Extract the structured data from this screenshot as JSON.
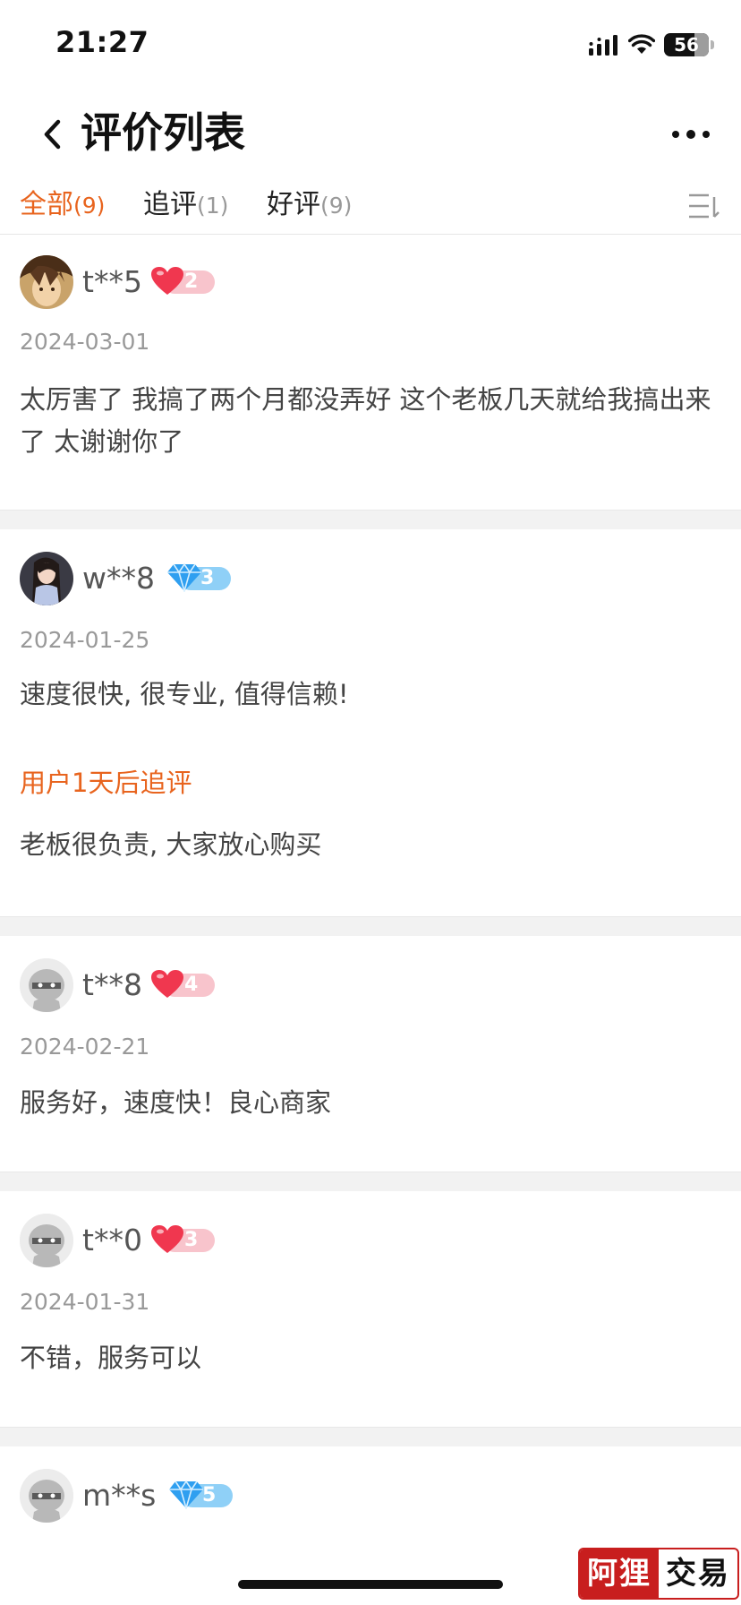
{
  "status_bar": {
    "time": "21:27",
    "battery": "56"
  },
  "nav": {
    "title": "评价列表"
  },
  "tabs": [
    {
      "label": "全部",
      "count": "(9)",
      "active": true
    },
    {
      "label": "追评",
      "count": "(1)",
      "active": false
    },
    {
      "label": "好评",
      "count": "(9)",
      "active": false
    }
  ],
  "reviews": [
    {
      "user": "t**5",
      "level_icon": "heart-icon",
      "level": "2",
      "date": "2024-03-01",
      "content": "太厉害了 我搞了两个月都没弄好 这个老板几天就给我搞出来了 太谢谢你了"
    },
    {
      "user": "w**8",
      "level_icon": "diamond-icon",
      "level": "3",
      "date": "2024-01-25",
      "content": "速度很快, 很专业, 值得信赖!",
      "followup_label": "用户1天后追评",
      "followup_content": "老板很负责, 大家放心购买"
    },
    {
      "user": "t**8",
      "level_icon": "heart-icon",
      "level": "4",
      "date": "2024-02-21",
      "content": "服务好，速度快！良心商家"
    },
    {
      "user": "t**0",
      "level_icon": "heart-icon",
      "level": "3",
      "date": "2024-01-31",
      "content": "不错，服务可以"
    },
    {
      "user": "m**s",
      "level_icon": "diamond-icon",
      "level": "5"
    }
  ],
  "watermark": {
    "left": "阿狸",
    "right": "交易"
  },
  "colors": {
    "accent": "#e8641e",
    "heart": "#f0374f",
    "diamond": "#3aa8f0"
  }
}
